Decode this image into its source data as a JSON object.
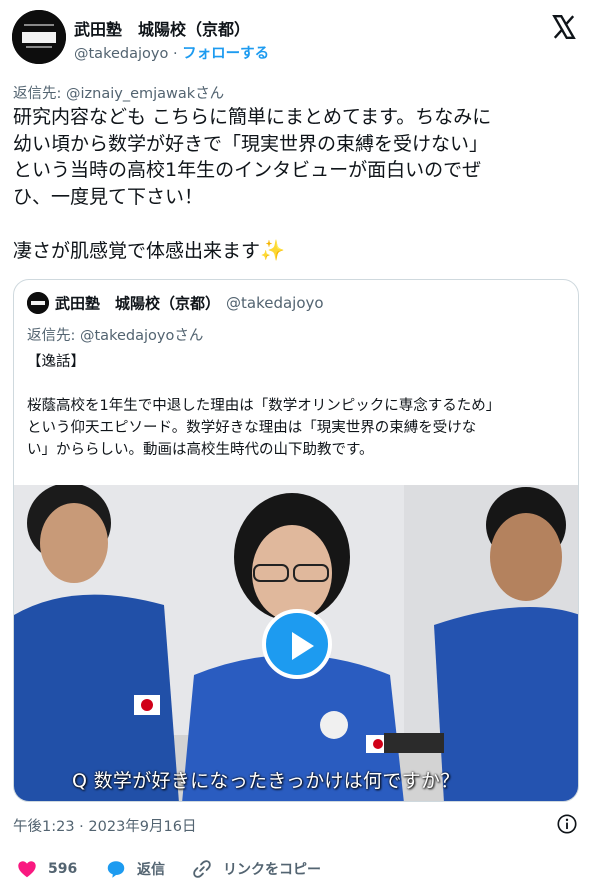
{
  "tweet": {
    "author_name": "武田塾　城陽校（京都）",
    "author_handle": "@takedajoyo",
    "separator": "·",
    "follow_label": "フォローする",
    "reply_to_prefix": "返信先: ",
    "reply_to_handle": "@iznaiy_emjawak",
    "reply_to_suffix": "さん",
    "body_lines": [
      "研究内容なども こちらに簡単にまとめてます。ちなみに",
      "幼い頃から数学が好きで「現実世界の束縛を受けない」",
      "という当時の高校1年生のインタビューが面白いのでぜ",
      "ひ、一度見て下さい！"
    ],
    "body_last_line": "凄さが肌感覚で体感出来ます",
    "timestamp": "午後1:23 · 2023年9月16日"
  },
  "quote": {
    "author_name": "武田塾　城陽校（京都）",
    "author_handle": "@takedajoyo",
    "reply_to_prefix": "返信先: ",
    "reply_to_handle": "@takedajoyo",
    "reply_to_suffix": "さん",
    "title": "【逸話】",
    "lines": [
      "桜蔭高校を1年生で中退した理由は「数学オリンピックに専念するため」",
      "という仰天エピソード。数学好きな理由は「現実世界の束縛を受けな",
      "い」かららしい。動画は高校生時代の山下助教です。"
    ],
    "video_caption": "Q 数学が好きになったきっかけは何ですか？"
  },
  "actions": {
    "like_count": "596",
    "reply_label": "返信",
    "copy_link_label": "リンクをコピー"
  },
  "colors": {
    "accent": "#1d9bf0",
    "like": "#f91880",
    "secondary_text": "#536471",
    "border": "#cfd9de"
  },
  "icons": {
    "brand": "x-logo-icon",
    "like": "heart-icon",
    "reply": "reply-bubble-icon",
    "copy": "link-icon",
    "info": "info-icon",
    "play": "play-icon"
  }
}
